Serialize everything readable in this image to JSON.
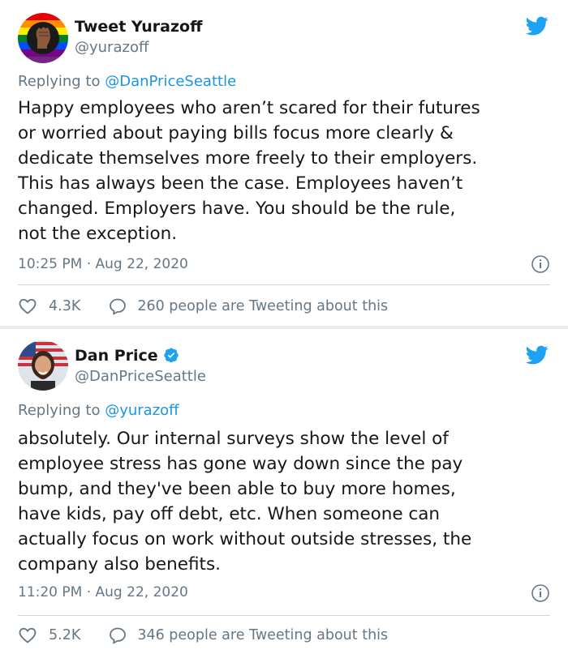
{
  "tweets": [
    {
      "author_name": "Tweet Yurazoff",
      "author_handle": "@yurazoff",
      "verified": false,
      "reply_prefix": "Replying to",
      "reply_to": "@DanPriceSeattle",
      "text": "Happy employees who aren’t scared for their futures\nor worried about paying bills focus more clearly &\ndedicate themselves more freely to their employers.\nThis has always been the case.  Employees haven’t\nchanged.  Employers have.  You should be the rule,\nnot the exception.",
      "timestamp": "10:25 PM · Aug 22, 2020",
      "likes": "4.3K",
      "conversation": "260 people are Tweeting about this"
    },
    {
      "author_name": "Dan Price",
      "author_handle": "@DanPriceSeattle",
      "verified": true,
      "reply_prefix": "Replying to",
      "reply_to": "@yurazoff",
      "text": "absolutely. Our internal surveys show the level of\nemployee stress has gone way down since the pay\nbump, and they've been able to buy more homes,\nhave kids, pay off debt, etc. When someone can\nactually focus on work without outside stresses, the\ncompany also benefits.",
      "timestamp": "11:20 PM · Aug 22, 2020",
      "likes": "5.2K",
      "conversation": "346 people are Tweeting about this"
    }
  ],
  "icons": {
    "brand": "twitter-bird-icon",
    "like": "heart-icon",
    "conversation": "speech-bubble-icon",
    "info": "info-icon",
    "verified": "verified-badge-icon"
  },
  "colors": {
    "brand_blue": "#1da1f2",
    "link_blue": "#1b95e0",
    "secondary_text": "#657786",
    "primary_text": "#14171a"
  }
}
